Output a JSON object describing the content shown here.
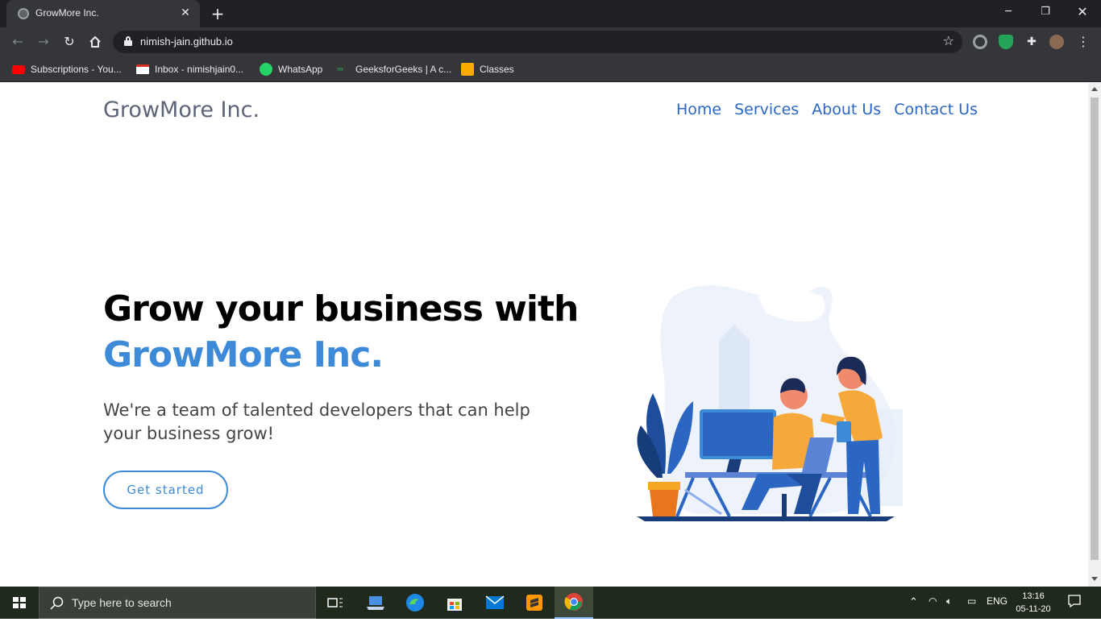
{
  "browser": {
    "tab_title": "GrowMore Inc.",
    "new_tab": "+",
    "url": "nimish-jain.github.io",
    "bookmarks": [
      {
        "label": "Subscriptions - You...",
        "icon": "youtube-icon"
      },
      {
        "label": "Inbox - nimishjain0...",
        "icon": "gmail-icon"
      },
      {
        "label": "WhatsApp",
        "icon": "whatsapp-icon"
      },
      {
        "label": "GeeksforGeeks | A c...",
        "icon": "geeksforgeeks-icon"
      },
      {
        "label": "Classes",
        "icon": "classroom-icon"
      }
    ]
  },
  "site": {
    "logo": "GrowMore Inc.",
    "nav": [
      "Home",
      "Services",
      "About Us",
      "Contact Us"
    ],
    "hero": {
      "title_line1": "Grow your business with",
      "title_line2": "GrowMore Inc.",
      "subtitle": "We're a team of talented developers that can help your business grow!",
      "cta": "Get started"
    },
    "colors": {
      "accent": "#3c8ad8",
      "nav_link": "#2a66c2",
      "logo": "#5e6477"
    }
  },
  "taskbar": {
    "search_placeholder": "Type here to search",
    "language": "ENG",
    "time": "13:16",
    "date": "05-11-20"
  }
}
